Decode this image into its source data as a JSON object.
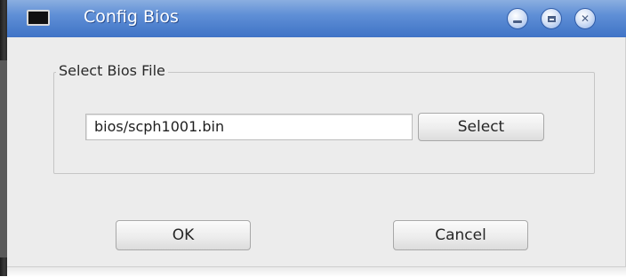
{
  "window": {
    "title": "Config Bios",
    "controls": {
      "minimize": "minimize-icon",
      "maximize": "maximize-icon",
      "close": "close-icon"
    }
  },
  "bios_group": {
    "legend": "Select Bios File",
    "path_value": "bios/scph1001.bin",
    "select_label": "Select"
  },
  "footer": {
    "ok_label": "OK",
    "cancel_label": "Cancel"
  },
  "colors": {
    "titlebar_accent": "#3f73c6",
    "client_background": "#ececec"
  }
}
